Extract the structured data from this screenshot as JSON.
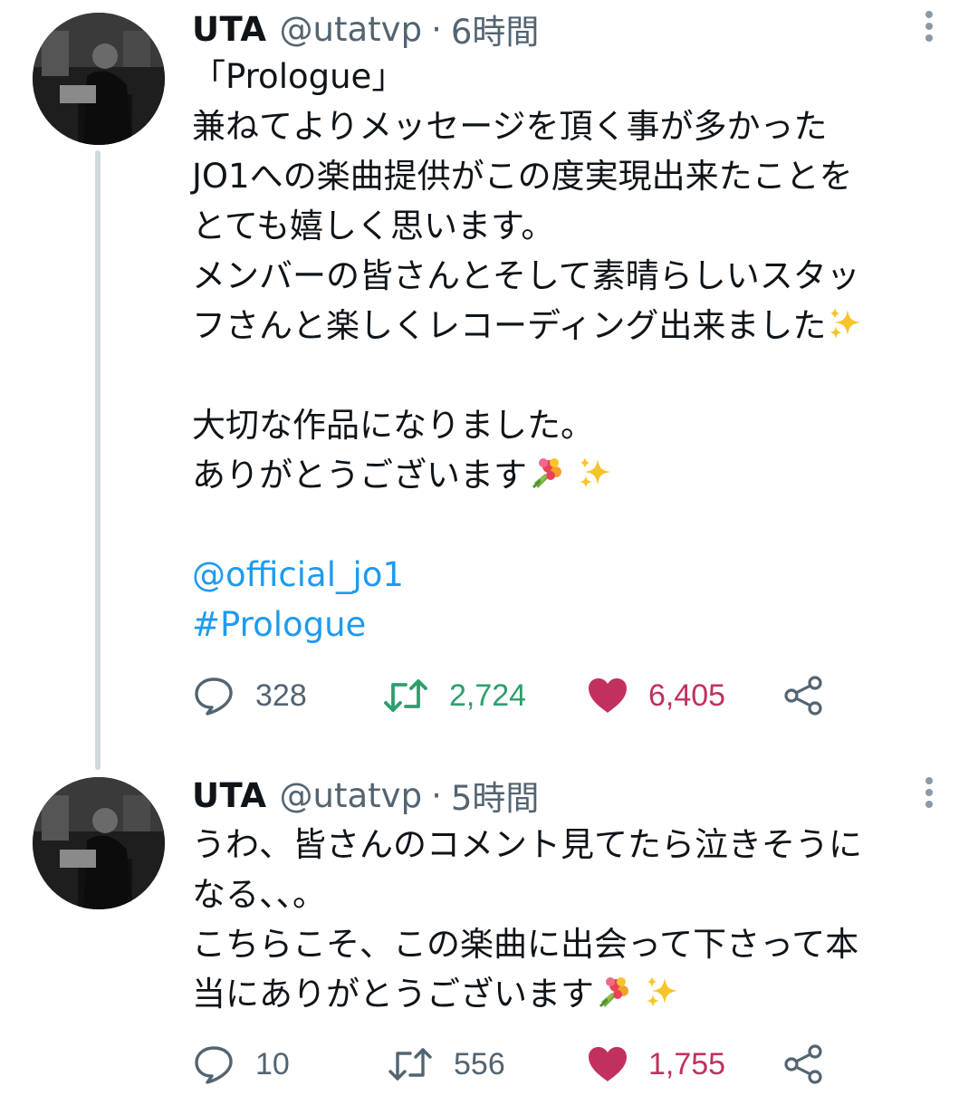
{
  "tweets": [
    {
      "author": {
        "name": "UTA",
        "handle": "@utatvp",
        "separator": "·",
        "time": "6時間"
      },
      "lines": [
        "「Prologue」",
        "兼ねてよりメッセージを頂く事が多かった",
        "JO1への楽曲提供がこの度実現出来たことを",
        "とても嬉しく思います。",
        "メンバーの皆さんとそして素晴らしいスタッ",
        "フさんと楽しくレコーディング出来ました",
        "大切な作品になりました。",
        "ありがとうございます"
      ],
      "mention": "@official_jo1",
      "hashtag": "#Prologue",
      "actions": {
        "replies": "328",
        "retweets": "2,724",
        "likes": "6,405"
      },
      "retweeted": true,
      "liked": true
    },
    {
      "author": {
        "name": "UTA",
        "handle": "@utatvp",
        "separator": "·",
        "time": "5時間"
      },
      "lines": [
        "うわ、皆さんのコメント見てたら泣きそうに",
        "なる、、。",
        "こちらこそ、この楽曲に出会って下さって本",
        "当にありがとうございます"
      ],
      "actions": {
        "replies": "10",
        "retweets": "556",
        "likes": "1,755"
      },
      "retweeted": false,
      "liked": true
    }
  ],
  "icons": {
    "reply": "reply-bubble-icon",
    "retweet": "retweet-icon",
    "like": "heart-icon",
    "share": "share-icon",
    "more": "more-vertical-icon",
    "sparkles": "sparkles-emoji",
    "bouquet": "bouquet-emoji"
  },
  "colors": {
    "text": "#0f1419",
    "secondary": "#536471",
    "link": "#1d9bf0",
    "retweet_active": "#2e9e6c",
    "like_active": "#c2315d",
    "thread_line": "#cfd9de"
  }
}
